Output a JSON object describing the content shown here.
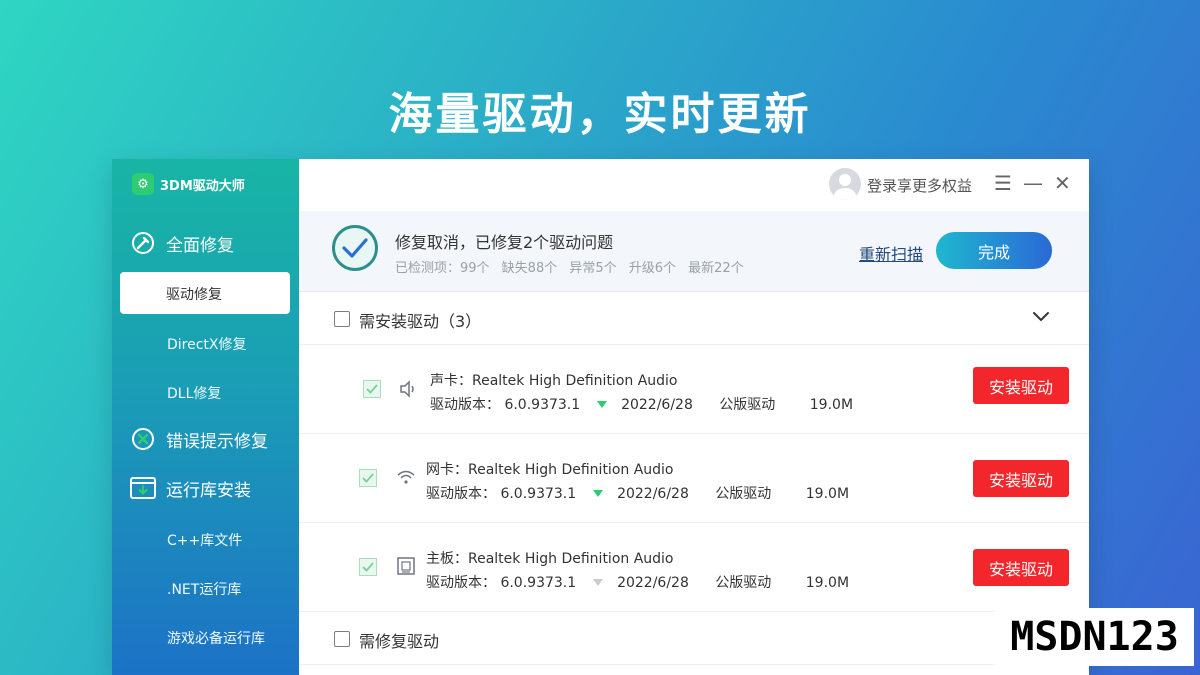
{
  "headline": "海量驱动，实时更新",
  "app": {
    "name": "3DM驱动大师"
  },
  "sidebar": {
    "groups": [
      {
        "label": "全面修复",
        "icon": "wrench-icon"
      },
      {
        "label": "错误提示修复",
        "icon": "error-x-icon"
      },
      {
        "label": "运行库安装",
        "icon": "download-box-icon"
      }
    ],
    "items": [
      {
        "label": "驱动修复",
        "active": true
      },
      {
        "label": "DirectX修复"
      },
      {
        "label": "DLL修复"
      },
      {
        "label": "C++库文件"
      },
      {
        "label": ".NET运行库"
      },
      {
        "label": "游戏必备运行库"
      }
    ]
  },
  "titlebar": {
    "login_text": "登录享更多权益",
    "menu_glyph": "☰",
    "minimize_glyph": "—",
    "close_glyph": "✕"
  },
  "status": {
    "title": "修复取消，已修复2个驱动问题",
    "summary": "已检测项：99个 缺失88个 异常5个 升级6个 最新22个",
    "rescan_label": "重新扫描",
    "done_label": "完成"
  },
  "sections": [
    {
      "label": "需安装驱动（3）"
    },
    {
      "label": "需修复驱动"
    }
  ],
  "drivers": [
    {
      "name": "声卡：Realtek High Definition Audio",
      "version_label": "驱动版本：",
      "version": "6.0.9373.1",
      "date": "2022/6/28",
      "type": "公版驱动",
      "size": "19.0M",
      "action": "安装驱动",
      "icon": "speaker-icon",
      "trend": "green"
    },
    {
      "name": "网卡：Realtek High Definition Audio",
      "version_label": "驱动版本：",
      "version": "6.0.9373.1",
      "date": "2022/6/28",
      "type": "公版驱动",
      "size": "19.0M",
      "action": "安装驱动",
      "icon": "wifi-icon",
      "trend": "green"
    },
    {
      "name": "主板：Realtek High Definition Audio",
      "version_label": "驱动版本：",
      "version": "6.0.9373.1",
      "date": "2022/6/28",
      "type": "公版驱动",
      "size": "19.0M",
      "action": "安装驱动",
      "icon": "motherboard-icon",
      "trend": "gray"
    }
  ],
  "colors": {
    "accent": "#2a69d6",
    "danger": "#f2262b",
    "trend_green": "#2ecc71",
    "trend_gray": "#c9ccd1"
  },
  "watermark": "MSDN123"
}
